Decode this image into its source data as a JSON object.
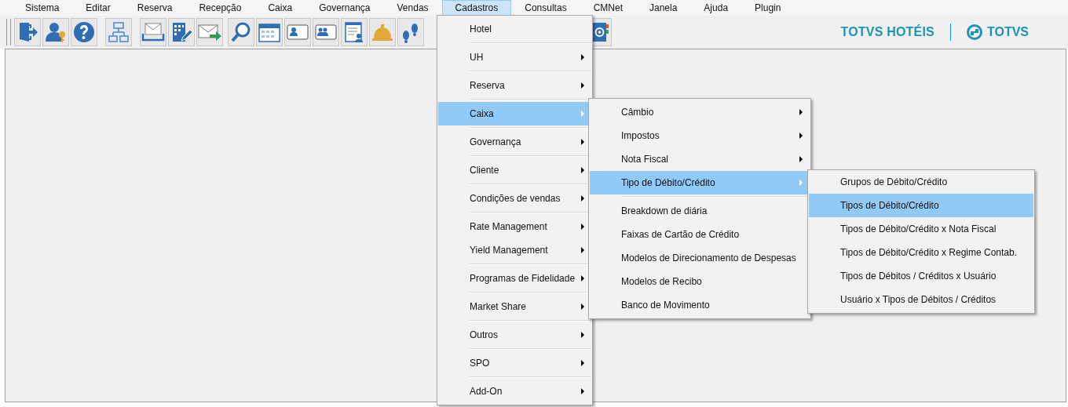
{
  "menu_bar": [
    {
      "label": "Sistema",
      "selected": false
    },
    {
      "label": "Editar",
      "selected": false
    },
    {
      "label": "Reserva",
      "selected": false
    },
    {
      "label": "Recepção",
      "selected": false
    },
    {
      "label": "Caixa",
      "selected": false
    },
    {
      "label": "Governança",
      "selected": false
    },
    {
      "label": "Vendas",
      "selected": false
    },
    {
      "label": "Cadastros",
      "selected": true
    },
    {
      "label": "Consultas",
      "selected": false
    },
    {
      "label": "CMNet",
      "selected": false
    },
    {
      "label": "Janela",
      "selected": false
    },
    {
      "label": "Ajuda",
      "selected": false
    },
    {
      "label": "Plugin",
      "selected": false
    }
  ],
  "logo": {
    "product": "TOTVS HOTÉIS",
    "brand": "TOTVS"
  },
  "cadastros_menu": [
    {
      "label": "Hotel",
      "submenu": false,
      "selected": false,
      "divider_below": true
    },
    {
      "label": "UH",
      "submenu": true,
      "selected": false,
      "divider_below": true
    },
    {
      "label": "Reserva",
      "submenu": true,
      "selected": false,
      "divider_below": true
    },
    {
      "label": "Caixa",
      "submenu": true,
      "selected": true,
      "divider_below": true
    },
    {
      "label": "Governança",
      "submenu": true,
      "selected": false,
      "divider_below": true
    },
    {
      "label": "Cliente",
      "submenu": true,
      "selected": false,
      "divider_below": true
    },
    {
      "label": "Condições de vendas",
      "submenu": true,
      "selected": false,
      "divider_below": true
    },
    {
      "label": "Rate Management",
      "submenu": true,
      "selected": false,
      "divider_below": false
    },
    {
      "label": "Yield Management",
      "submenu": true,
      "selected": false,
      "divider_below": true
    },
    {
      "label": "Programas de Fidelidade",
      "submenu": true,
      "selected": false,
      "divider_below": true
    },
    {
      "label": "Market Share",
      "submenu": true,
      "selected": false,
      "divider_below": true
    },
    {
      "label": "Outros",
      "submenu": true,
      "selected": false,
      "divider_below": true
    },
    {
      "label": "SPO",
      "submenu": true,
      "selected": false,
      "divider_below": true
    },
    {
      "label": "Add-On",
      "submenu": true,
      "selected": false,
      "divider_below": false
    }
  ],
  "caixa_submenu": [
    {
      "label": "Câmbio",
      "submenu": true,
      "selected": false,
      "divider_below": false
    },
    {
      "label": "Impostos",
      "submenu": true,
      "selected": false,
      "divider_below": false
    },
    {
      "label": "Nota Fiscal",
      "submenu": true,
      "selected": false,
      "divider_below": false
    },
    {
      "label": "Tipo de Débito/Crédito",
      "submenu": true,
      "selected": true,
      "divider_below": true
    },
    {
      "label": "Breakdown de diária",
      "submenu": false,
      "selected": false,
      "divider_below": false
    },
    {
      "label": "Faixas de Cartão de Crédito",
      "submenu": false,
      "selected": false,
      "divider_below": false
    },
    {
      "label": "Modelos de Direcionamento de Despesas",
      "submenu": false,
      "selected": false,
      "divider_below": false
    },
    {
      "label": "Modelos de Recibo",
      "submenu": false,
      "selected": false,
      "divider_below": false
    },
    {
      "label": "Banco de Movimento",
      "submenu": false,
      "selected": false,
      "divider_below": false
    }
  ],
  "tipo_submenu": [
    {
      "label": "Grupos de Débito/Crédito",
      "submenu": false,
      "selected": false,
      "divider_below": false
    },
    {
      "label": "Tipos de Débito/Crédito",
      "submenu": false,
      "selected": true,
      "divider_below": false
    },
    {
      "label": "Tipos de Débito/Crédito x Nota Fiscal",
      "submenu": false,
      "selected": false,
      "divider_below": false
    },
    {
      "label": "Tipos de Débito/Crédito x Regime Contab.",
      "submenu": false,
      "selected": false,
      "divider_below": false
    },
    {
      "label": "Tipos de Débitos / Créditos x Usuário",
      "submenu": false,
      "selected": false,
      "divider_below": false
    },
    {
      "label": "Usuário x Tipos de Débitos / Créditos",
      "submenu": false,
      "selected": false,
      "divider_below": false
    }
  ]
}
